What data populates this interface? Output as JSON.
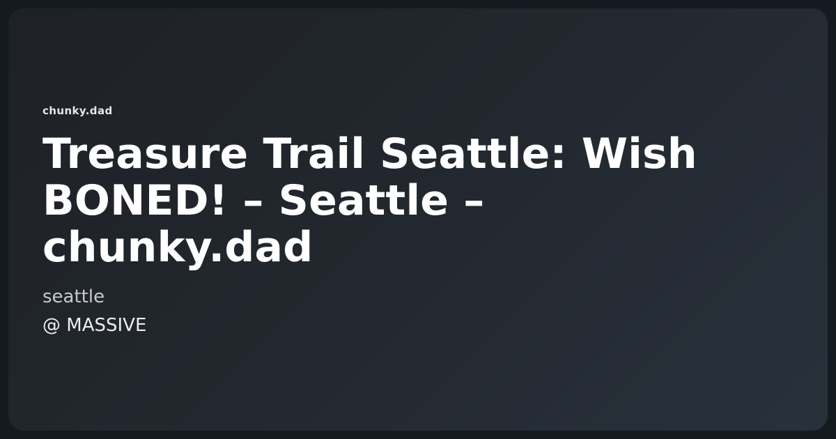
{
  "card": {
    "site_name": "chunky.dad",
    "title": "Treasure Trail Seattle: Wish BONED! – Seattle – chunky.dad",
    "city": "seattle",
    "venue": "@ MASSIVE"
  },
  "colors": {
    "page_background": "#151a20",
    "card_gradient_start": "#1e2126",
    "card_gradient_end": "#28313b",
    "title_text": "#ffffff",
    "subtitle_text": "#c7cace"
  }
}
